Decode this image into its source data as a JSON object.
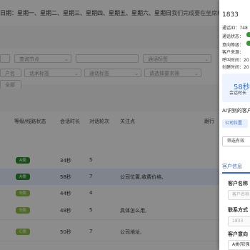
{
  "header": {
    "date_label": "日期：",
    "weekdays": "星期一、星期二、星期三、星期四、星期五、星期六、星期日",
    "hint": "(我们完成要在坐席标"
  },
  "filters": {
    "row1": [
      "",
      "查询节点",
      "",
      "通话标签"
    ],
    "row2": [
      "户名",
      "话术标签",
      "通话标签",
      "请选择要求筛"
    ],
    "row3_partial": "全部"
  },
  "table": {
    "columns": [
      "等级/线路状态",
      "会话时长",
      "对话轮次",
      "关注点",
      "跟行"
    ],
    "rows": [
      {
        "grade": "A类",
        "grade_color": "#2f8f2f",
        "duration": "34秒",
        "turns": "5",
        "focus": "",
        "highlight": false
      },
      {
        "grade": "A类",
        "grade_color": "#2f8f2f",
        "duration": "58秒",
        "turns": "7",
        "focus": "公司位置,收费价格,",
        "highlight": true
      },
      {
        "grade": "B类",
        "grade_color": "#8fbf4a",
        "duration": "44秒",
        "turns": "4",
        "focus": "",
        "highlight": false
      },
      {
        "grade": "B类",
        "grade_color": "#8fbf4a",
        "duration": "48秒",
        "turns": "5",
        "focus": "具体怎么用,",
        "highlight": false
      },
      {
        "grade": "C类",
        "grade_color": "#8fbf4a",
        "duration": "50秒",
        "turns": "7",
        "focus": "公司地址,",
        "highlight": false
      }
    ]
  },
  "drawer": {
    "phone": "1833",
    "call_id": "通话ID：748",
    "call_status": "通话状态：",
    "intent_level": "意向等级：",
    "source": "客户来源：",
    "call_time": "呼叫时间：20",
    "created_time": "创建时间：20",
    "stat_value": "58秒",
    "stat_label": "会话时长",
    "ai_title": "AI识别的客户",
    "chip": "公司位置",
    "filter_btn": "筛选有效",
    "tab_info": "客户信息",
    "name_label": "客户名称",
    "name_placeholder": "客户名称",
    "contact_label": "联系方式",
    "contact_value": "1833",
    "intent_label": "客户意向",
    "intent_value": "A类(较强"
  },
  "colors": {
    "accent": "#3b6ecf",
    "green": "#2f9a2f"
  }
}
